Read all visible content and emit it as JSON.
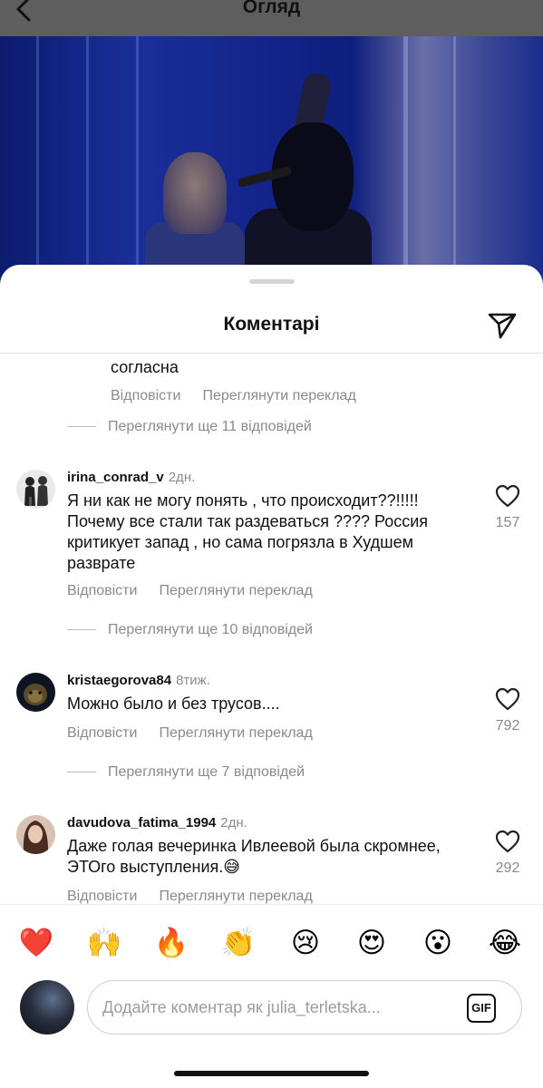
{
  "header": {
    "title": "Огляд",
    "back_icon": "chevron-left-icon"
  },
  "sheet": {
    "title": "Коментарі",
    "share_icon": "paper-plane-icon"
  },
  "reply_fragment": {
    "text": "согласна",
    "reply_label": "Відповісти",
    "translate_label": "Переглянути переклад"
  },
  "comments": [
    {
      "more_replies": "Переглянути ще 11 відповідей"
    },
    {
      "username": "irina_conrad_v",
      "time": "2дн.",
      "text": "Я ни как не могу понять , что происходит??!!!!! Почему все стали так раздеваться ???? Россия критикует запад , но сама погрязла в Худшем разврате",
      "reply_label": "Відповісти",
      "translate_label": "Переглянути переклад",
      "likes": "157",
      "more_replies": "Переглянути ще 10 відповідей"
    },
    {
      "username": "kristaegorova84",
      "time": "8тиж.",
      "text": "Можно было и без трусов....",
      "reply_label": "Відповісти",
      "translate_label": "Переглянути переклад",
      "likes": "792",
      "more_replies": "Переглянути ще 7 відповідей"
    },
    {
      "username": "davudova_fatima_1994",
      "time": "2дн.",
      "text": "Даже  голая вечеринка Ивлеевой была скромнее, ЭТОго выступления.😅",
      "reply_label": "Відповісти",
      "translate_label": "Переглянути переклад",
      "likes": "292"
    }
  ],
  "emoji_bar": [
    "❤️",
    "🙌",
    "🔥",
    "👏",
    "😢",
    "😍",
    "😮",
    "😂"
  ],
  "input": {
    "placeholder": "Додайте коментар як julia_terletska...",
    "gif_label": "GIF"
  },
  "colors": {
    "secondary_text": "#8a8a8a",
    "sheet_bg": "#ffffff",
    "video_blue": "#13238a"
  }
}
